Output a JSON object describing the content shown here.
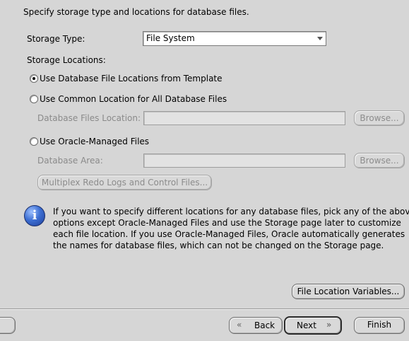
{
  "header": {
    "instruction": "Specify storage type and locations for database files."
  },
  "storage": {
    "type_label": "Storage Type:",
    "type_value": "File System",
    "locations_label": "Storage Locations:"
  },
  "options": {
    "template": "Use Database File Locations from Template",
    "common": "Use Common Location for All Database Files",
    "managed": "Use Oracle-Managed Files",
    "selected": "template"
  },
  "fields": {
    "files_location_label": "Database Files Location:",
    "files_location_value": "",
    "area_label": "Database Area:",
    "area_value": ""
  },
  "buttons": {
    "browse": "Browse...",
    "multiplex": "Multiplex Redo Logs and Control Files...",
    "file_location_vars": "File Location Variables...",
    "back": "Back",
    "next": "Next",
    "finish": "Finish"
  },
  "info": {
    "icon": "info-icon",
    "lines": [
      "If you want to specify different locations for any database files, pick any of the above",
      "options except Oracle-Managed Files and use the Storage page later to customize",
      "each file location. If you use Oracle-Managed Files, Oracle automatically generates",
      "the names for database files, which can not be changed on the Storage page."
    ]
  }
}
